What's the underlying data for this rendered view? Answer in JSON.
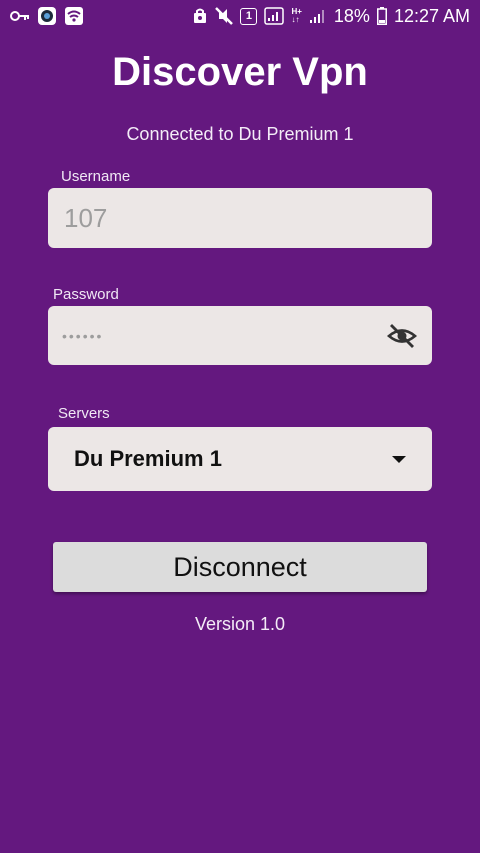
{
  "status_bar": {
    "battery": "18%",
    "time": "12:27 AM",
    "sim_slot": "1",
    "network_type": "H+",
    "icons": [
      "key-icon",
      "camera-app-icon",
      "wifi-icon",
      "sync-icon",
      "mute-icon",
      "sim-icon",
      "signal-icon",
      "data-icon",
      "signal-weak-icon",
      "battery-icon"
    ]
  },
  "app": {
    "title": "Discover Vpn",
    "connection_status": "Connected to Du Premium 1",
    "version": "Version 1.0"
  },
  "form": {
    "username_label": "Username",
    "username_value": "107",
    "password_label": "Password",
    "password_masked": "••••••",
    "servers_label": "Servers",
    "selected_server": "Du Premium 1",
    "disconnect_label": "Disconnect"
  },
  "colors": {
    "background": "#64187f",
    "field": "#ece7e6",
    "button": "#dcdcdc"
  }
}
